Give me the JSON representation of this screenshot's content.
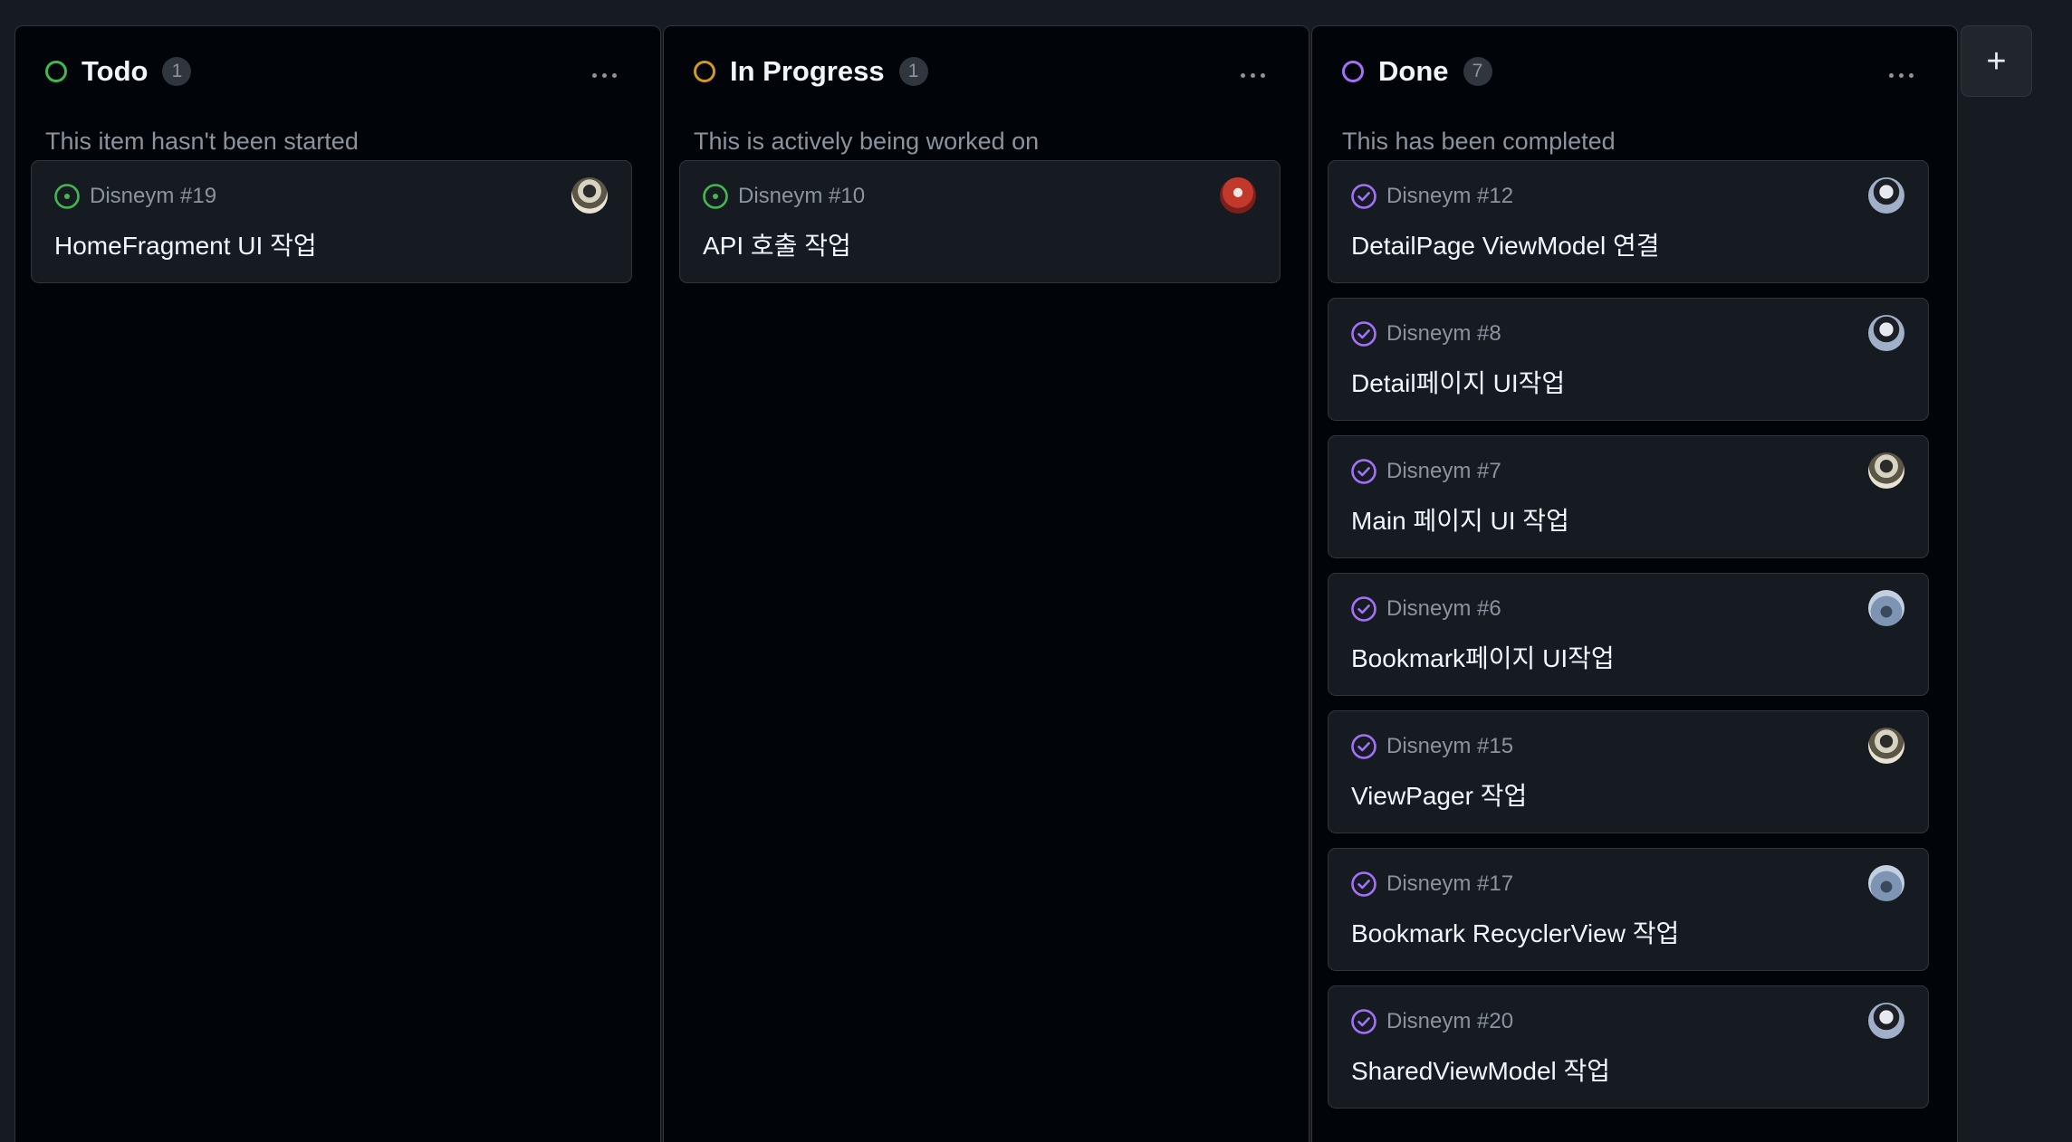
{
  "colors": {
    "todo": "#3fb950",
    "in_progress": "#d29922",
    "done": "#a371f7",
    "background": "#010409",
    "card": "#161b22"
  },
  "columns": [
    {
      "title": "Todo",
      "count": "1",
      "description": "This item hasn't been started",
      "status_icon": "open-circle-green",
      "cards": [
        {
          "ref": "Disneym #19",
          "title": "HomeFragment UI 작업",
          "state_icon": "issue-open-icon",
          "avatar": "avatar-user-a"
        }
      ]
    },
    {
      "title": "In Progress",
      "count": "1",
      "description": "This is actively being worked on",
      "status_icon": "open-circle-orange",
      "cards": [
        {
          "ref": "Disneym #10",
          "title": "API 호출 작업",
          "state_icon": "issue-open-icon",
          "avatar": "avatar-user-b"
        }
      ]
    },
    {
      "title": "Done",
      "count": "7",
      "description": "This has been completed",
      "status_icon": "open-circle-purple",
      "cards": [
        {
          "ref": "Disneym #12",
          "title": "DetailPage ViewModel 연결",
          "state_icon": "issue-closed-icon",
          "avatar": "avatar-user-c"
        },
        {
          "ref": "Disneym #8",
          "title": "Detail페이지 UI작업",
          "state_icon": "issue-closed-icon",
          "avatar": "avatar-user-c"
        },
        {
          "ref": "Disneym #7",
          "title": "Main 페이지 UI 작업",
          "state_icon": "issue-closed-icon",
          "avatar": "avatar-user-a"
        },
        {
          "ref": "Disneym #6",
          "title": "Bookmark페이지 UI작업",
          "state_icon": "issue-closed-icon",
          "avatar": "avatar-user-d"
        },
        {
          "ref": "Disneym #15",
          "title": "ViewPager 작업",
          "state_icon": "issue-closed-icon",
          "avatar": "avatar-user-a"
        },
        {
          "ref": "Disneym #17",
          "title": "Bookmark RecyclerView 작업",
          "state_icon": "issue-closed-icon",
          "avatar": "avatar-user-d"
        },
        {
          "ref": "Disneym #20",
          "title": "SharedViewModel 작업",
          "state_icon": "issue-closed-icon",
          "avatar": "avatar-user-c"
        }
      ]
    }
  ],
  "add_column": {
    "label": "+"
  }
}
